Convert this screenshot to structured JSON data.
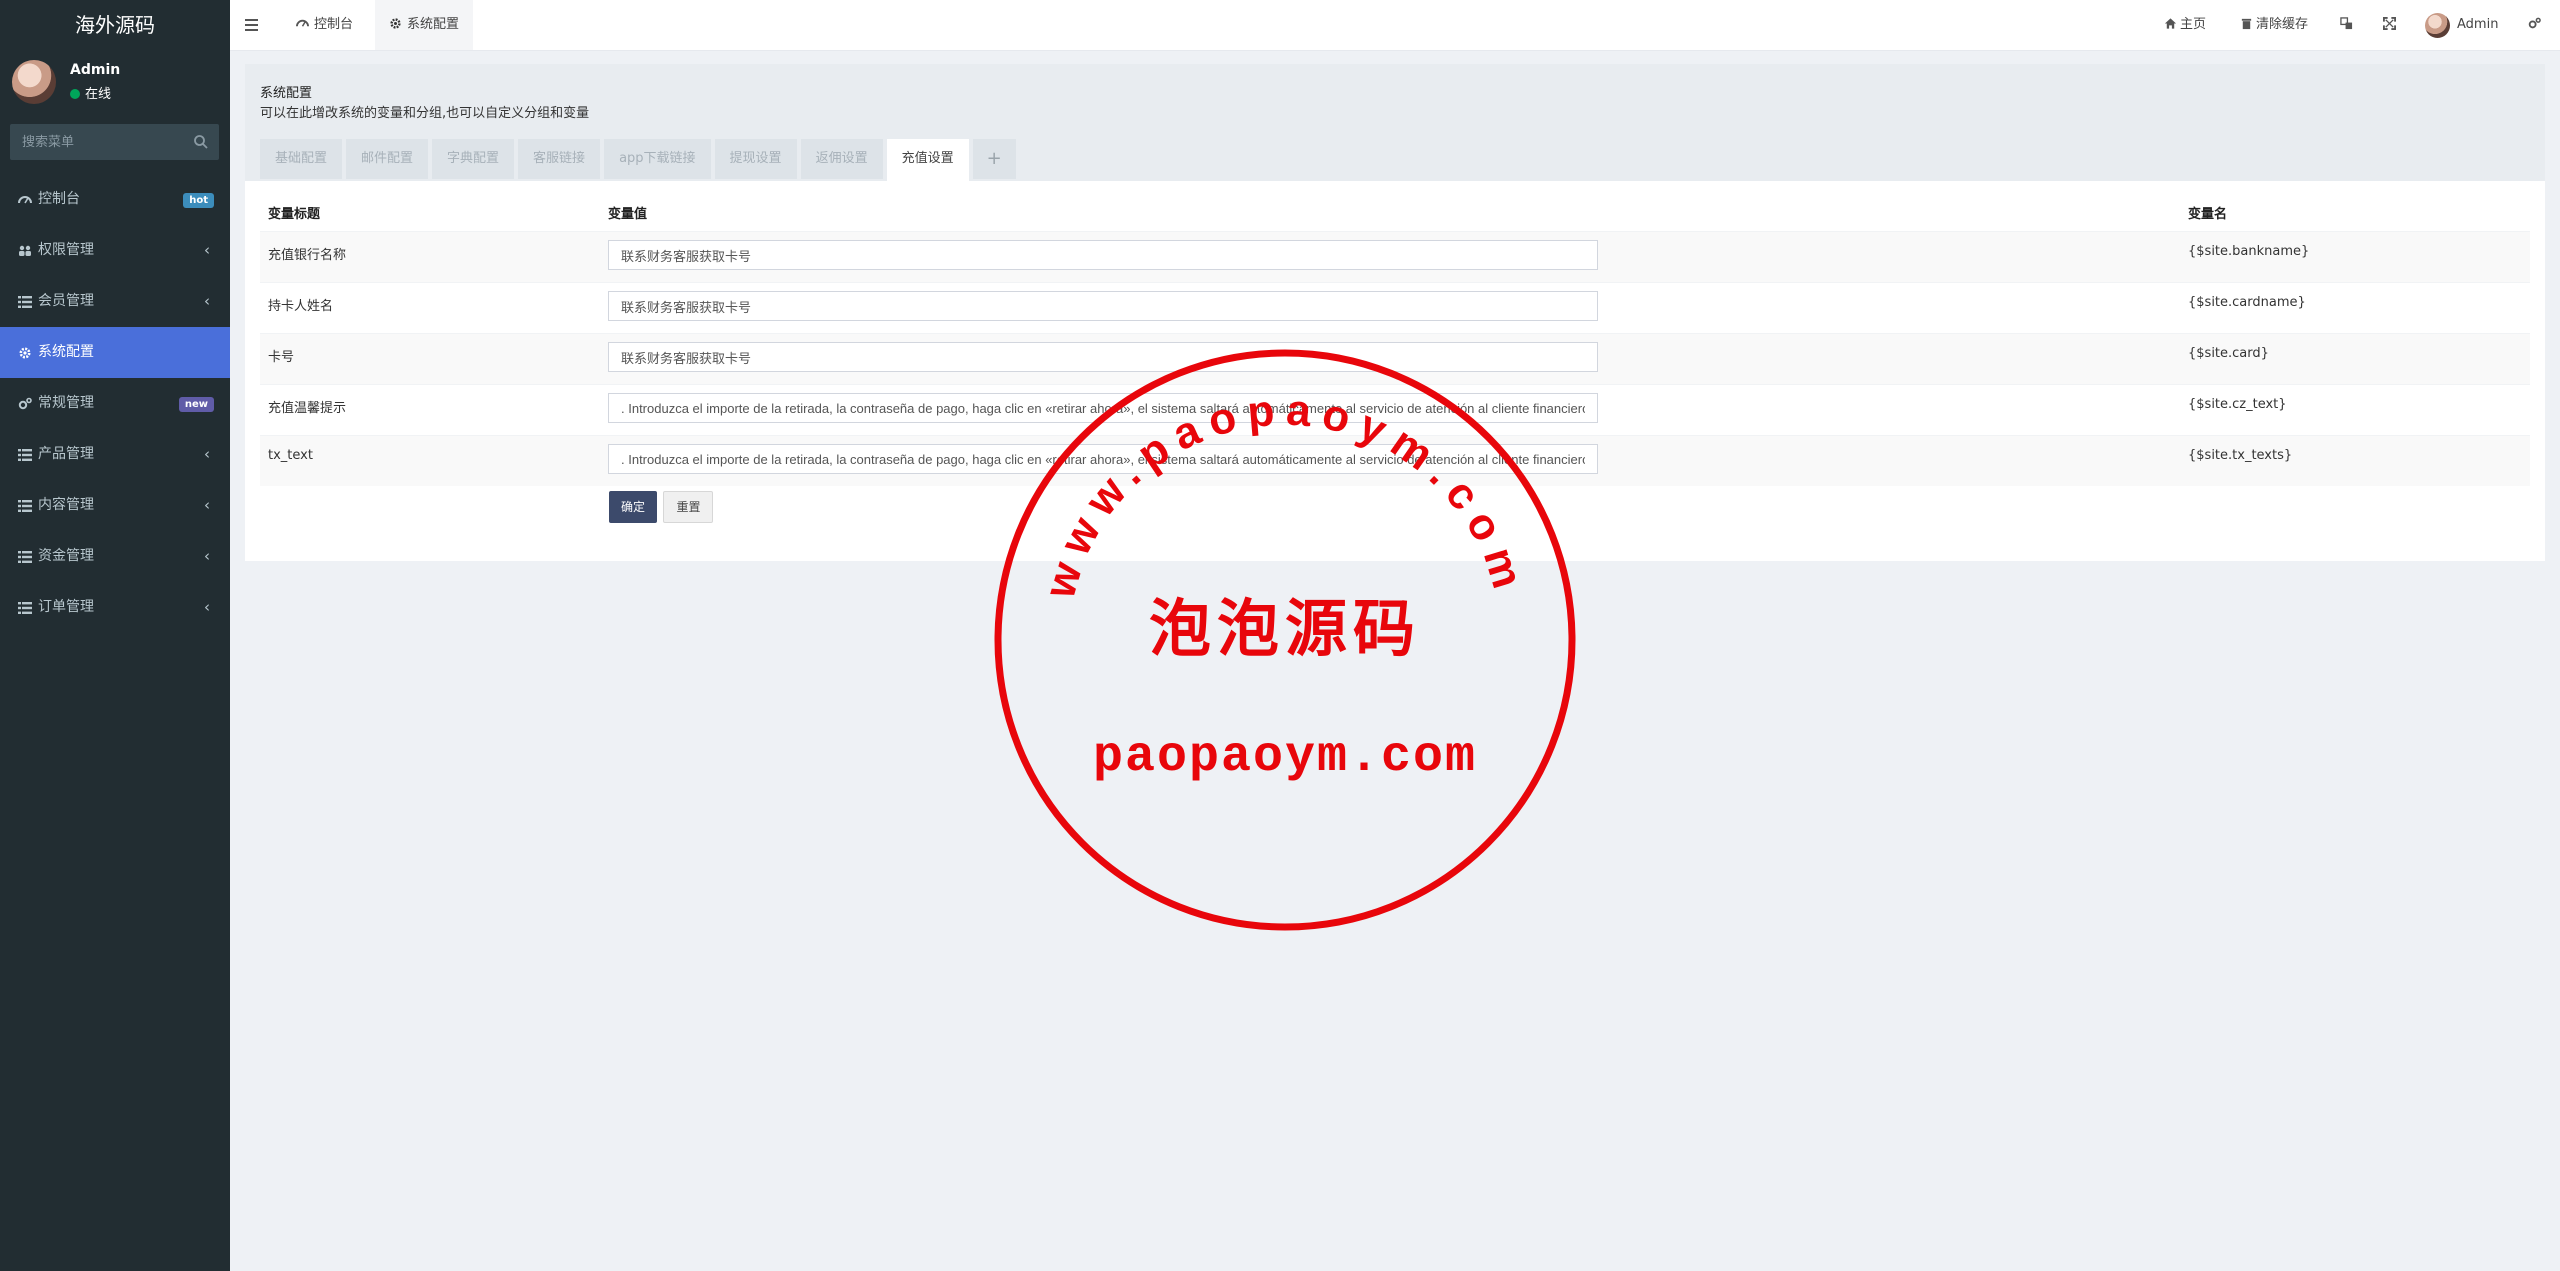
{
  "app": {
    "title": "海外源码"
  },
  "user": {
    "name": "Admin",
    "status": "在线"
  },
  "sidebar": {
    "search_placeholder": "搜索菜单",
    "items": [
      {
        "label": "控制台",
        "badge": "hot",
        "icon": "dashboard-icon"
      },
      {
        "label": "权限管理",
        "arrow": "‹",
        "icon": "group-icon"
      },
      {
        "label": "会员管理",
        "arrow": "‹",
        "icon": "list-icon"
      },
      {
        "label": "系统配置",
        "icon": "gear-icon",
        "active": true
      },
      {
        "label": "常规管理",
        "badge": "new",
        "icon": "cogs-icon"
      },
      {
        "label": "产品管理",
        "arrow": "‹",
        "icon": "list-icon"
      },
      {
        "label": "内容管理",
        "arrow": "‹",
        "icon": "list-icon"
      },
      {
        "label": "资金管理",
        "arrow": "‹",
        "icon": "list-icon"
      },
      {
        "label": "订单管理",
        "arrow": "‹",
        "icon": "list-icon"
      }
    ]
  },
  "header": {
    "tabs": [
      {
        "label": "控制台",
        "icon": "dashboard-icon"
      },
      {
        "label": "系统配置",
        "icon": "gear-icon",
        "active": true
      }
    ],
    "right": {
      "home": "主页",
      "clear_cache": "清除缓存",
      "user": "Admin"
    }
  },
  "page": {
    "title": "系统配置",
    "description": "可以在此增改系统的变量和分组,也可以自定义分组和变量",
    "tabs": [
      "基础配置",
      "邮件配置",
      "字典配置",
      "客服链接",
      "app下载链接",
      "提现设置",
      "返佣设置",
      "充值设置",
      "+"
    ],
    "active_tab": "充值设置"
  },
  "table": {
    "headers": {
      "title": "变量标题",
      "value": "变量值",
      "name": "变量名"
    },
    "rows": [
      {
        "title": "充值银行名称",
        "value": "联系财务客服获取卡号",
        "name": "{$site.bankname}"
      },
      {
        "title": "持卡人姓名",
        "value": "联系财务客服获取卡号",
        "name": "{$site.cardname}"
      },
      {
        "title": "卡号",
        "value": "联系财务客服获取卡号",
        "name": "{$site.card}"
      },
      {
        "title": "充值温馨提示",
        "value": ". Introduzca el importe de la retirada, la contraseña de pago, haga clic en «retirar ahora», el sistema saltará automáticamente al servicio de atención al cliente financiero para",
        "name": "{$site.cz_text}"
      },
      {
        "title": "tx_text",
        "value": ". Introduzca el importe de la retirada, la contraseña de pago, haga clic en «retirar ahora», el sistema saltará automáticamente al servicio de atención al cliente financiero para",
        "name": "{$site.tx_texts}"
      }
    ]
  },
  "buttons": {
    "submit": "确定",
    "reset": "重置"
  },
  "stamp": {
    "arc_text": "www.paopaoym.com",
    "center_text": "泡泡源码",
    "bottom_text": "paopaoym.com",
    "color": "#e8060b"
  },
  "colors": {
    "sidebar_bg": "#222d32",
    "active": "#4a6fda",
    "primary_btn": "#3c4a6b"
  }
}
